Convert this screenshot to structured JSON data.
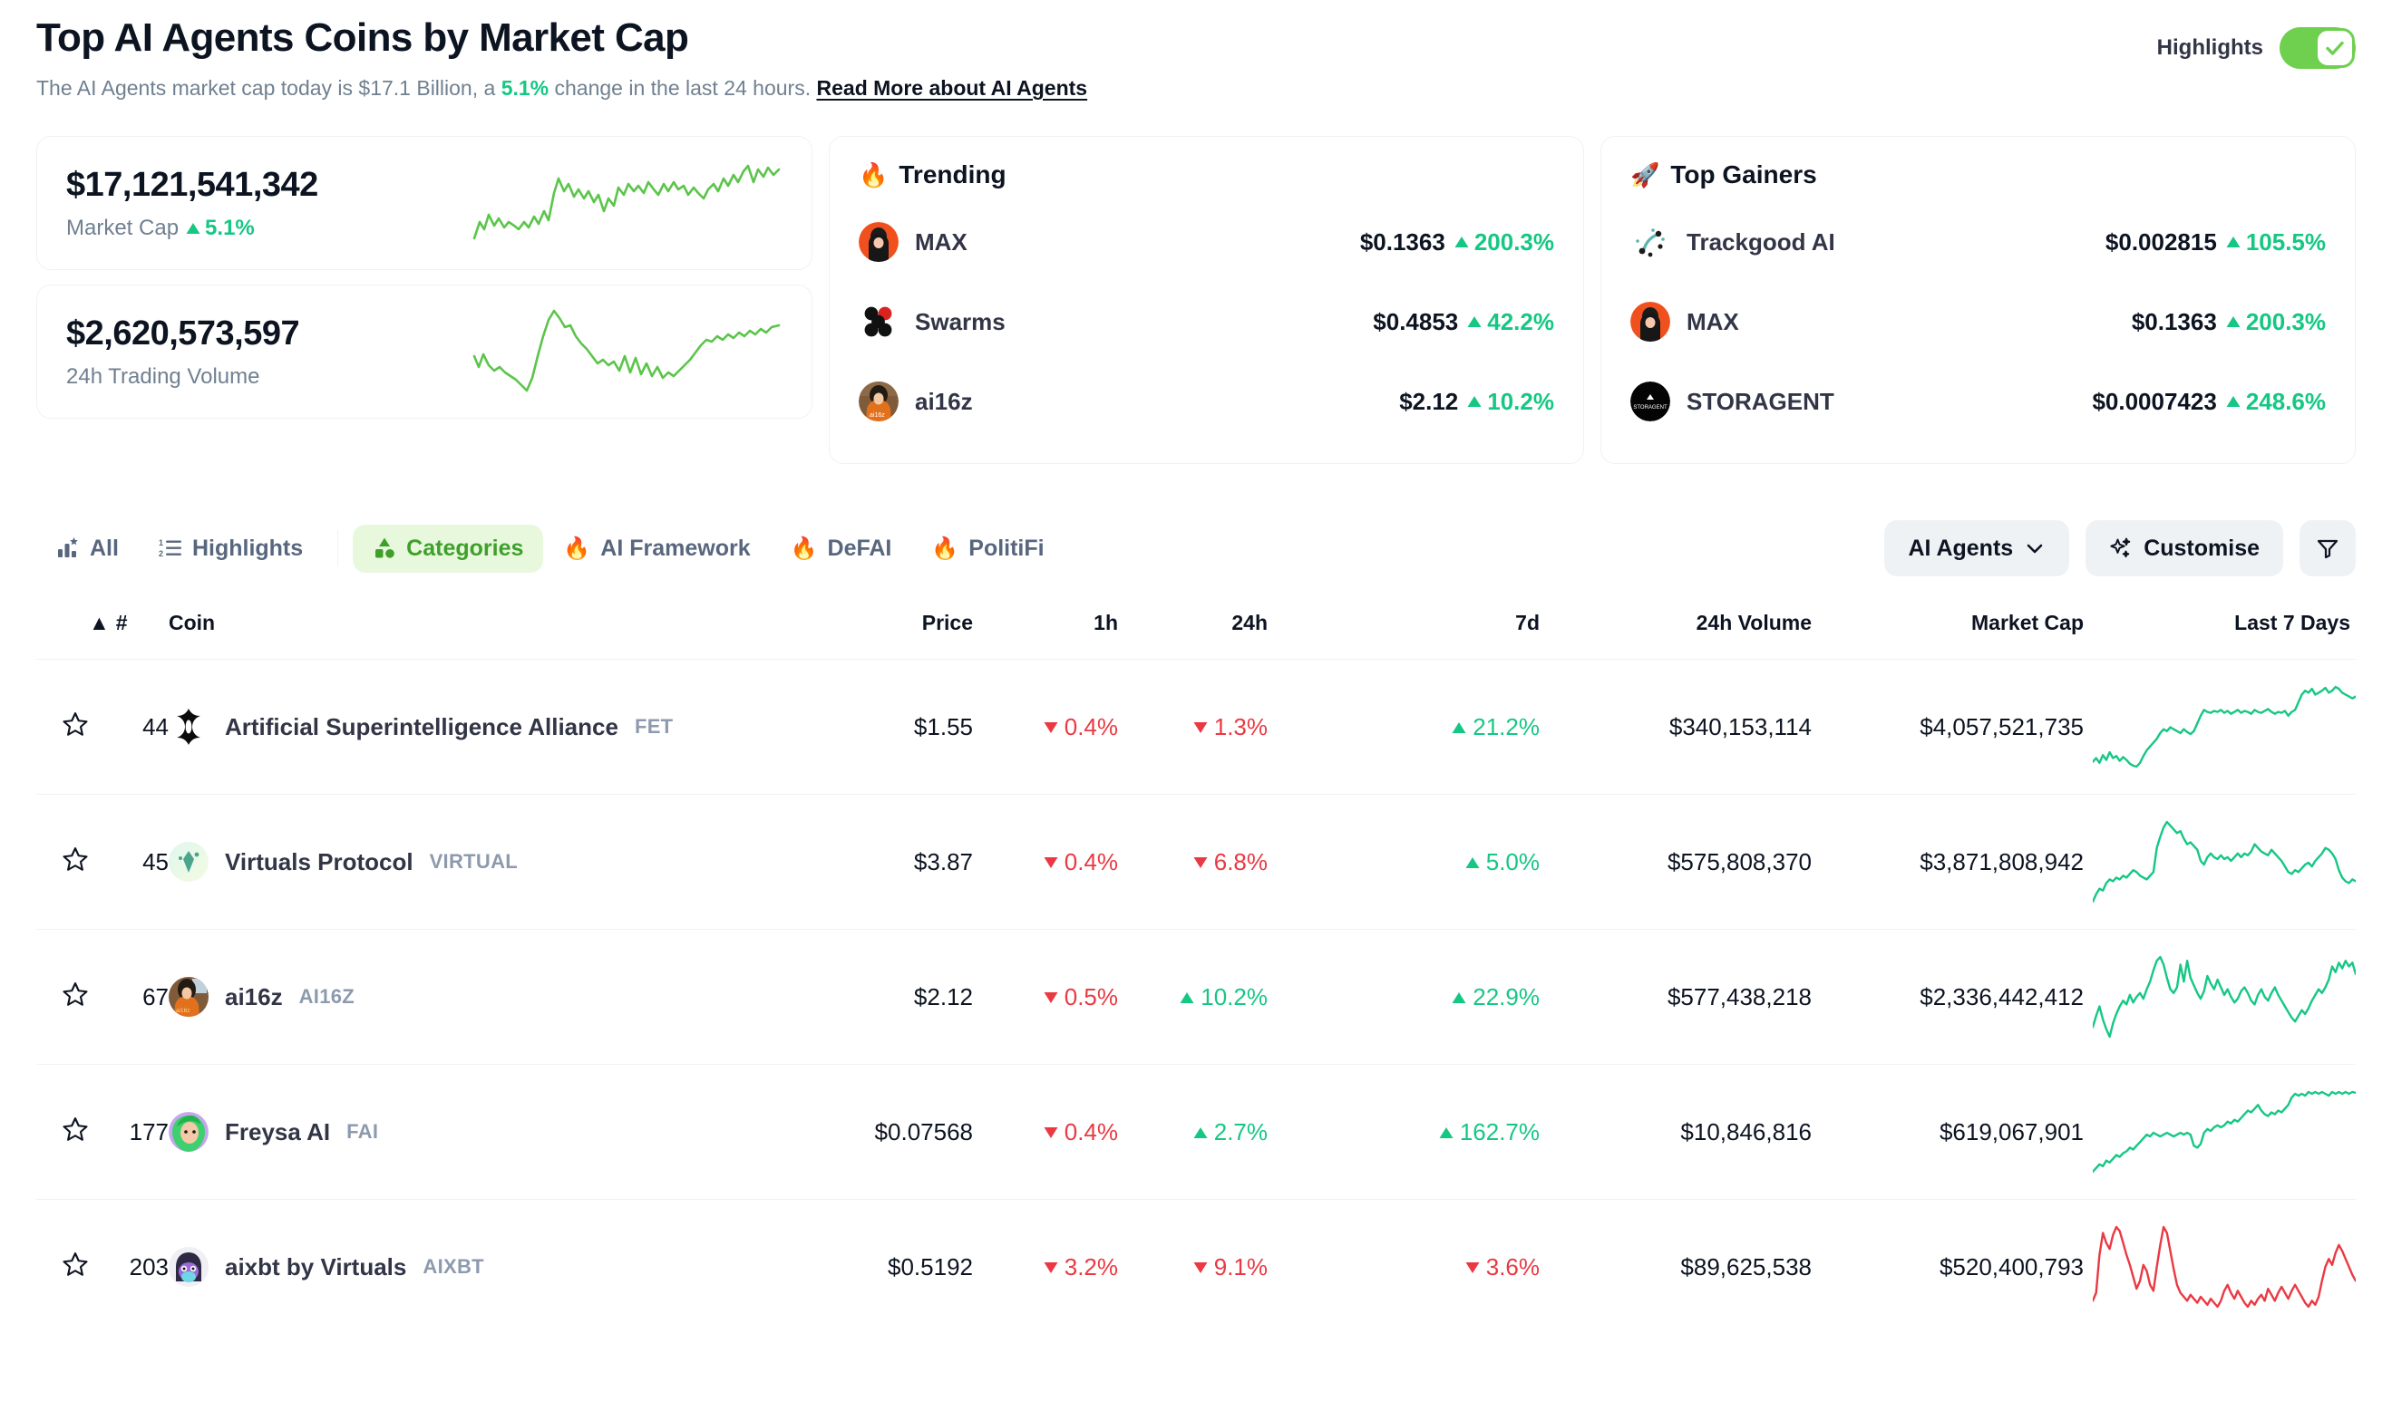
{
  "header": {
    "title": "Top AI Agents Coins by Market Cap",
    "subtitle_prefix": "The AI Agents market cap today is $17.1 Billion, a ",
    "subtitle_change": "5.1%",
    "subtitle_suffix": " change in the last 24 hours. ",
    "read_more": "Read More about AI Agents",
    "highlights_label": "Highlights",
    "highlights_on": true
  },
  "stats": [
    {
      "value": "$17,121,541,342",
      "label": "Market Cap",
      "change": "5.1%",
      "direction": "up"
    },
    {
      "value": "$2,620,573,597",
      "label": "24h Trading Volume",
      "change": "",
      "direction": "none"
    }
  ],
  "trending": {
    "title": "Trending",
    "emoji": "🔥",
    "rows": [
      {
        "name": "MAX",
        "price": "$0.1363",
        "change": "200.3%",
        "direction": "up",
        "icon": "max-avatar"
      },
      {
        "name": "Swarms",
        "price": "$0.4853",
        "change": "42.2%",
        "direction": "up",
        "icon": "swarms-logo"
      },
      {
        "name": "ai16z",
        "price": "$2.12",
        "change": "10.2%",
        "direction": "up",
        "icon": "ai16z-avatar"
      }
    ]
  },
  "top_gainers": {
    "title": "Top Gainers",
    "emoji": "🚀",
    "rows": [
      {
        "name": "Trackgood AI",
        "price": "$0.002815",
        "change": "105.5%",
        "direction": "up",
        "icon": "trackgood-logo"
      },
      {
        "name": "MAX",
        "price": "$0.1363",
        "change": "200.3%",
        "direction": "up",
        "icon": "max-avatar"
      },
      {
        "name": "STORAGENT",
        "price": "$0.0007423",
        "change": "248.6%",
        "direction": "up",
        "icon": "storagent-logo"
      }
    ]
  },
  "tabs": [
    {
      "label": "All",
      "icon": "bar-chart-star-icon",
      "active": false,
      "emoji": ""
    },
    {
      "label": "Highlights",
      "icon": "ordered-list-icon",
      "active": false,
      "emoji": ""
    },
    {
      "label": "Categories",
      "icon": "categories-icon",
      "active": true,
      "emoji": ""
    },
    {
      "label": "AI Framework",
      "icon": "fire-icon",
      "active": false,
      "emoji": "🔥"
    },
    {
      "label": "DeFAI",
      "icon": "fire-icon",
      "active": false,
      "emoji": "🔥"
    },
    {
      "label": "PolitiFi",
      "icon": "fire-icon",
      "active": false,
      "emoji": "🔥"
    }
  ],
  "toolbar": {
    "category_select": "AI Agents",
    "customise_label": "Customise",
    "filter_icon": "funnel-icon"
  },
  "table": {
    "columns": [
      "#",
      "Coin",
      "Price",
      "1h",
      "24h",
      "7d",
      "24h Volume",
      "Market Cap",
      "Last 7 Days"
    ],
    "sort_indicator": "▲",
    "rows": [
      {
        "rank": "44",
        "name": "Artificial Superintelligence Alliance",
        "symbol": "FET",
        "icon": "fet-logo",
        "price": "$1.55",
        "h1": {
          "value": "0.4%",
          "direction": "down"
        },
        "h24": {
          "value": "1.3%",
          "direction": "down"
        },
        "d7": {
          "value": "21.2%",
          "direction": "up"
        },
        "volume": "$340,153,114",
        "market_cap": "$4,057,521,735",
        "spark_color": "#16c784",
        "spark": [
          18,
          22,
          17,
          25,
          20,
          28,
          22,
          24,
          19,
          23,
          20,
          16,
          14,
          13,
          17,
          24,
          30,
          34,
          38,
          42,
          48,
          52,
          50,
          54,
          52,
          50,
          48,
          52,
          49,
          47,
          50,
          58,
          66,
          72,
          70,
          69,
          71,
          70,
          72,
          69,
          71,
          68,
          70,
          72,
          69,
          71,
          70,
          68,
          72,
          70,
          69,
          71,
          73,
          70,
          68,
          70,
          69,
          71,
          66,
          70,
          72,
          80,
          88,
          92,
          90,
          94,
          88,
          90,
          92,
          95,
          90,
          92,
          96,
          94,
          90,
          88,
          86,
          84,
          86
        ]
      },
      {
        "rank": "45",
        "name": "Virtuals Protocol",
        "symbol": "VIRTUAL",
        "icon": "virtual-logo",
        "price": "$3.87",
        "h1": {
          "value": "0.4%",
          "direction": "down"
        },
        "h24": {
          "value": "6.8%",
          "direction": "down"
        },
        "d7": {
          "value": "5.0%",
          "direction": "up"
        },
        "volume": "$575,808,370",
        "market_cap": "$3,871,808,942",
        "spark_color": "#16c784",
        "spark": [
          10,
          18,
          24,
          22,
          30,
          34,
          32,
          36,
          34,
          38,
          36,
          40,
          44,
          42,
          38,
          36,
          34,
          38,
          42,
          68,
          80,
          90,
          96,
          92,
          88,
          84,
          86,
          78,
          72,
          74,
          70,
          66,
          54,
          50,
          58,
          62,
          58,
          56,
          60,
          56,
          58,
          54,
          58,
          62,
          58,
          62,
          60,
          64,
          72,
          68,
          64,
          62,
          60,
          66,
          62,
          58,
          54,
          48,
          42,
          40,
          44,
          42,
          46,
          50,
          52,
          48,
          54,
          58,
          62,
          68,
          66,
          62,
          56,
          44,
          36,
          32,
          30,
          34,
          32
        ]
      },
      {
        "rank": "67",
        "name": "ai16z",
        "symbol": "AI16Z",
        "icon": "ai16z-avatar",
        "price": "$2.12",
        "h1": {
          "value": "0.5%",
          "direction": "down"
        },
        "h24": {
          "value": "10.2%",
          "direction": "up"
        },
        "d7": {
          "value": "22.9%",
          "direction": "up"
        },
        "volume": "$577,438,218",
        "market_cap": "$2,336,442,412",
        "spark_color": "#16c784",
        "spark": [
          22,
          34,
          44,
          30,
          20,
          12,
          26,
          36,
          44,
          50,
          46,
          56,
          48,
          54,
          58,
          52,
          62,
          70,
          82,
          92,
          96,
          88,
          74,
          62,
          58,
          64,
          88,
          70,
          92,
          74,
          66,
          58,
          52,
          60,
          76,
          68,
          62,
          72,
          64,
          56,
          62,
          54,
          48,
          52,
          60,
          64,
          58,
          50,
          46,
          56,
          62,
          54,
          50,
          58,
          64,
          56,
          50,
          44,
          38,
          32,
          28,
          34,
          40,
          36,
          42,
          50,
          56,
          62,
          58,
          64,
          72,
          86,
          80,
          90,
          84,
          92,
          86,
          90,
          78
        ]
      },
      {
        "rank": "177",
        "name": "Freysa AI",
        "symbol": "FAI",
        "icon": "freysa-avatar",
        "price": "$0.07568",
        "h1": {
          "value": "0.4%",
          "direction": "down"
        },
        "h24": {
          "value": "2.7%",
          "direction": "up"
        },
        "d7": {
          "value": "162.7%",
          "direction": "up"
        },
        "volume": "$10,846,816",
        "market_cap": "$619,067,901",
        "spark_color": "#16c784",
        "spark": [
          8,
          12,
          16,
          14,
          20,
          18,
          22,
          26,
          24,
          28,
          30,
          34,
          32,
          36,
          40,
          44,
          48,
          46,
          50,
          48,
          46,
          48,
          50,
          48,
          46,
          48,
          50,
          48,
          50,
          48,
          36,
          34,
          38,
          50,
          54,
          52,
          56,
          58,
          56,
          58,
          62,
          60,
          64,
          62,
          66,
          70,
          74,
          72,
          76,
          80,
          74,
          70,
          68,
          72,
          70,
          74,
          72,
          76,
          80,
          88,
          92,
          90,
          92,
          90,
          94,
          92,
          94,
          92,
          94,
          92,
          90,
          94,
          92,
          94,
          92,
          94,
          92,
          94,
          93
        ]
      },
      {
        "rank": "203",
        "name": "aixbt by Virtuals",
        "symbol": "AIXBT",
        "icon": "aixbt-avatar",
        "price": "$0.5192",
        "h1": {
          "value": "3.2%",
          "direction": "down"
        },
        "h24": {
          "value": "9.1%",
          "direction": "down"
        },
        "d7": {
          "value": "3.6%",
          "direction": "down"
        },
        "volume": "$89,625,538",
        "market_cap": "$520,400,793",
        "spark_color": "#ea3943",
        "spark": [
          14,
          22,
          60,
          82,
          72,
          66,
          80,
          88,
          84,
          72,
          60,
          50,
          38,
          26,
          34,
          50,
          44,
          30,
          24,
          48,
          70,
          88,
          82,
          64,
          46,
          30,
          22,
          18,
          14,
          20,
          16,
          12,
          18,
          14,
          10,
          16,
          12,
          8,
          14,
          24,
          30,
          22,
          16,
          24,
          18,
          12,
          8,
          14,
          10,
          16,
          20,
          14,
          26,
          20,
          14,
          22,
          28,
          22,
          16,
          24,
          30,
          24,
          18,
          12,
          8,
          14,
          10,
          18,
          34,
          48,
          56,
          50,
          62,
          70,
          64,
          56,
          48,
          40,
          34
        ]
      }
    ]
  },
  "colors": {
    "up": "#16c784",
    "down": "#ea3943",
    "accent": "#3ea02b",
    "text": "#0d1421",
    "muted": "#708090"
  }
}
